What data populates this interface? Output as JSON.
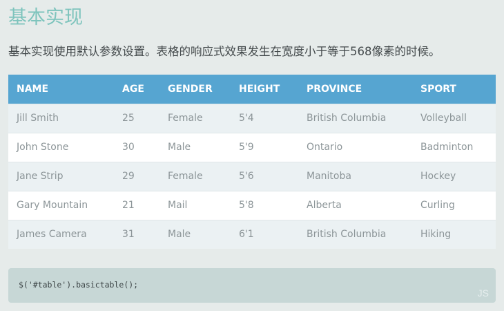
{
  "page": {
    "title": "基本实现",
    "description": "基本实现使用默认参数设置。表格的响应式效果发生在宽度小于等于568像素的时候。"
  },
  "table": {
    "headers": [
      "NAME",
      "AGE",
      "GENDER",
      "HEIGHT",
      "PROVINCE",
      "SPORT"
    ],
    "rows": [
      [
        "Jill Smith",
        "25",
        "Female",
        "5'4",
        "British Columbia",
        "Volleyball"
      ],
      [
        "John Stone",
        "30",
        "Male",
        "5'9",
        "Ontario",
        "Badminton"
      ],
      [
        "Jane Strip",
        "29",
        "Female",
        "5'6",
        "Manitoba",
        "Hockey"
      ],
      [
        "Gary Mountain",
        "21",
        "Mail",
        "5'8",
        "Alberta",
        "Curling"
      ],
      [
        "James Camera",
        "31",
        "Male",
        "6'1",
        "British Columbia",
        "Hiking"
      ]
    ]
  },
  "code_block": {
    "code": "$('#table').basictable();",
    "language": "JS"
  },
  "colors": {
    "title": "#7ec4bd",
    "header_bg": "#56a5d1",
    "odd_row_bg": "#ebf1f3",
    "even_row_bg": "#ffffff",
    "code_bg": "#c7d7d6",
    "page_bg": "#e6ebea"
  }
}
